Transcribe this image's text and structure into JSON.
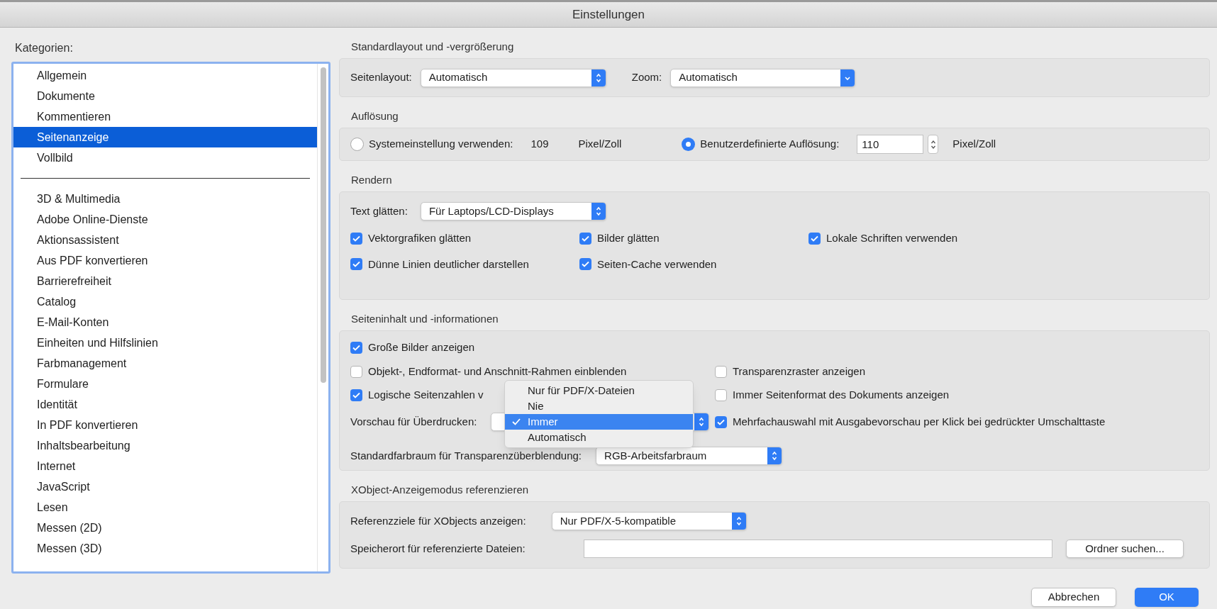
{
  "window": {
    "title": "Einstellungen"
  },
  "categories": {
    "label": "Kategorien:",
    "primary_items": [
      {
        "label": "Allgemein",
        "selected": false
      },
      {
        "label": "Dokumente",
        "selected": false
      },
      {
        "label": "Kommentieren",
        "selected": false
      },
      {
        "label": "Seitenanzeige",
        "selected": true
      },
      {
        "label": "Vollbild",
        "selected": false
      }
    ],
    "secondary_items": [
      {
        "label": "3D & Multimedia",
        "selected": false
      },
      {
        "label": "Adobe Online-Dienste",
        "selected": false
      },
      {
        "label": "Aktionsassistent",
        "selected": false
      },
      {
        "label": "Aus PDF konvertieren",
        "selected": false
      },
      {
        "label": "Barrierefreiheit",
        "selected": false
      },
      {
        "label": "Catalog",
        "selected": false
      },
      {
        "label": "E-Mail-Konten",
        "selected": false
      },
      {
        "label": "Einheiten und Hilfslinien",
        "selected": false
      },
      {
        "label": "Farbmanagement",
        "selected": false
      },
      {
        "label": "Formulare",
        "selected": false
      },
      {
        "label": "Identität",
        "selected": false
      },
      {
        "label": "In PDF konvertieren",
        "selected": false
      },
      {
        "label": "Inhaltsbearbeitung",
        "selected": false
      },
      {
        "label": "Internet",
        "selected": false
      },
      {
        "label": "JavaScript",
        "selected": false
      },
      {
        "label": "Lesen",
        "selected": false
      },
      {
        "label": "Messen (2D)",
        "selected": false
      },
      {
        "label": "Messen (3D)",
        "selected": false
      }
    ]
  },
  "layout": {
    "title": "Standardlayout und -vergrößerung",
    "fields": [
      {
        "label": "Seitenlayout:",
        "value": "Automatisch",
        "kind": "popup"
      },
      {
        "label": "Zoom:",
        "value": "Automatisch",
        "kind": "combo"
      }
    ]
  },
  "resolution": {
    "title": "Auflösung",
    "options": [
      {
        "label": "Systemeinstellung verwenden:",
        "kind": "reading",
        "value": "109",
        "unit": "Pixel/Zoll",
        "selected": false
      },
      {
        "label": "Benutzerdefinierte Auflösung:",
        "kind": "input",
        "value": "110",
        "unit": "Pixel/Zoll",
        "selected": true
      }
    ]
  },
  "rendering": {
    "title": "Rendern",
    "smooth_text": {
      "label": "Text glätten:",
      "value": "Für Laptops/LCD-Displays"
    },
    "checkboxes": [
      {
        "label": "Vektorgrafiken glätten",
        "checked": true
      },
      {
        "label": "Bilder glätten",
        "checked": true
      },
      {
        "label": "Lokale Schriften verwenden",
        "checked": true
      },
      {
        "label": "Dünne Linien deutlicher darstellen",
        "checked": true
      },
      {
        "label": "Seiten-Cache verwenden",
        "checked": true
      }
    ]
  },
  "page_content": {
    "title": "Seiteninhalt und -informationen",
    "rows": [
      [
        {
          "kind": "checkbox",
          "label": "Große Bilder anzeigen",
          "checked": true
        }
      ],
      [
        {
          "kind": "checkbox",
          "label": "Objekt-, Endformat- und Anschnitt-Rahmen einblenden",
          "checked": false
        },
        {
          "kind": "checkbox",
          "label": "Transparenzraster anzeigen",
          "checked": false
        }
      ],
      [
        {
          "kind": "checkbox",
          "label": "Logische Seitenzahlen v",
          "checked": true
        },
        {
          "kind": "checkbox",
          "label": "Immer Seitenformat des Dokuments anzeigen",
          "checked": false
        }
      ],
      [
        {
          "kind": "select",
          "label": "Vorschau für Überdrucken:"
        },
        {
          "kind": "checkbox",
          "label": "Mehrfachauswahl mit Ausgabevorschau per Klick bei gedrückter Umschalttaste",
          "checked": true
        }
      ],
      [
        {
          "kind": "select",
          "label": "Standardfarbraum für Transparenzüberblendung:",
          "value": "RGB-Arbeitsfarbraum"
        }
      ]
    ],
    "menu": [
      {
        "label": "Nur für PDF/X-Dateien",
        "selected": false
      },
      {
        "label": "Nie",
        "selected": false
      },
      {
        "label": "Immer",
        "selected": true
      },
      {
        "label": "Automatisch",
        "selected": false
      }
    ]
  },
  "xobject": {
    "title": "XObject-Anzeigemodus referenzieren",
    "targets": {
      "label": "Referenzziele für XObjects anzeigen:",
      "value": "Nur PDF/X-5-kompatible"
    },
    "location": {
      "label": "Speicherort für referenzierte Dateien:",
      "button": "Ordner suchen..."
    }
  },
  "buttons": [
    {
      "label": "Abbrechen",
      "default": false
    },
    {
      "label": "OK",
      "default": true
    }
  ]
}
